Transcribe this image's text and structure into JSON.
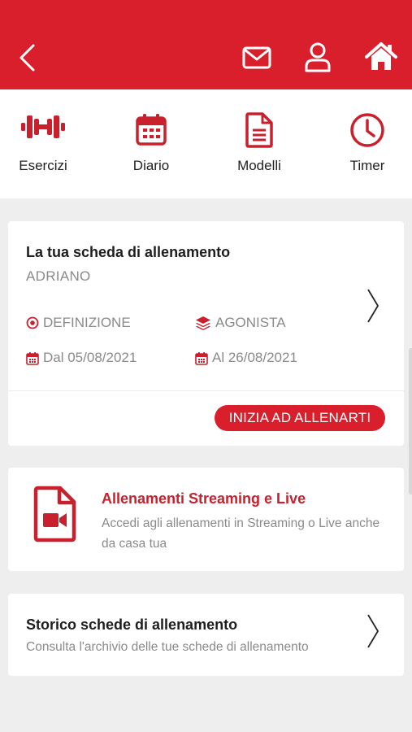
{
  "colors": {
    "brand_red": "#da1f2c",
    "accent_text_red": "#c8202c",
    "muted_text": "#8a8a8a",
    "page_bg": "#eeeeee"
  },
  "header": {
    "icons": [
      "chevron-left-icon",
      "mail-icon",
      "user-icon",
      "home-icon"
    ]
  },
  "quicknav": {
    "items": [
      {
        "label": "Esercizi",
        "icon": "dumbbell-icon"
      },
      {
        "label": "Diario",
        "icon": "calendar-icon"
      },
      {
        "label": "Modelli",
        "icon": "document-icon"
      },
      {
        "label": "Timer",
        "icon": "clock-icon"
      }
    ]
  },
  "plan_card": {
    "title": "La tua scheda di allenamento",
    "owner": "ADRIANO",
    "goal": "DEFINIZIONE",
    "level": "AGONISTA",
    "date_from": "Dal 05/08/2021",
    "date_to": "Al 26/08/2021",
    "start_label": "INIZIA AD ALLENARTI"
  },
  "streaming_card": {
    "title": "Allenamenti Streaming e Live",
    "description": "Accedi agli allenamenti in Streaming o Live anche da casa tua"
  },
  "history_card": {
    "title": "Storico schede di allenamento",
    "description": "Consulta l'archivio delle tue schede di allenamento"
  }
}
